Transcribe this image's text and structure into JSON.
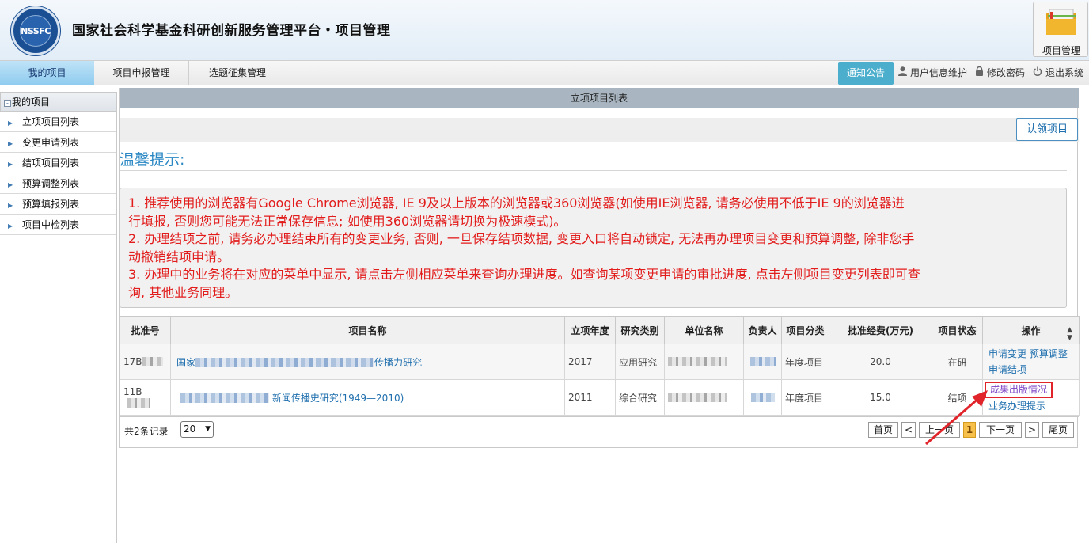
{
  "header": {
    "logo_text": "NSSFC",
    "title": "国家社会科学基金科研创新服务管理平台・项目管理",
    "module_label": "项目管理"
  },
  "nav": {
    "tabs": [
      "我的项目",
      "项目申报管理",
      "选题征集管理"
    ],
    "notice": "通知公告",
    "user_info": "用户信息维护",
    "change_pwd": "修改密码",
    "logout": "退出系统"
  },
  "sidebar": {
    "header": "我的项目",
    "items": [
      "立项项目列表",
      "变更申请列表",
      "结项项目列表",
      "预算调整列表",
      "预算填报列表",
      "项目中检列表"
    ]
  },
  "main": {
    "panel_title": "立项项目列表",
    "claim_button": "认领项目",
    "tips_title": "温馨提示:",
    "tips": [
      "1. 推荐使用的浏览器有Google Chrome浏览器, IE 9及以上版本的浏览器或360浏览器(如使用IE浏览器, 请务必使用不低于IE 9的浏览器进",
      "行填报, 否则您可能无法正常保存信息; 如使用360浏览器请切换为极速模式)。",
      "2. 办理结项之前, 请务必办理结束所有的变更业务, 否则, 一旦保存结项数据, 变更入口将自动锁定, 无法再办理项目变更和预算调整, 除非您手",
      "动撤销结项申请。",
      "3. 办理中的业务将在对应的菜单中显示, 请点击左侧相应菜单来查询办理进度。如查询某项变更申请的审批进度, 点击左侧项目变更列表即可查",
      "询, 其他业务同理。"
    ]
  },
  "table": {
    "columns": [
      "批准号",
      "项目名称",
      "立项年度",
      "研究类别",
      "单位名称",
      "负责人",
      "项目分类",
      "批准经费(万元)",
      "项目状态",
      "操作"
    ],
    "rows": [
      {
        "id_prefix": "17B",
        "name_prefix": "国家",
        "name_suffix": "传播力研究",
        "year": "2017",
        "category": "应用研究",
        "type": "年度项目",
        "funding": "20.0",
        "status": "在研",
        "ops": [
          "申请变更",
          "预算调整",
          "申请结项"
        ]
      },
      {
        "id_prefix": "11B",
        "name_prefix": "",
        "name_suffix": "新闻传播史研究(1949—2010)",
        "year": "2011",
        "category": "综合研究",
        "type": "年度项目",
        "funding": "15.0",
        "status": "结项",
        "ops": [
          "成果出版情况",
          "业务办理提示"
        ]
      }
    ]
  },
  "pager": {
    "record_count": "共2条记录",
    "page_size": "20",
    "first": "首页",
    "prev": "<",
    "up": "上一页",
    "current": "1",
    "down": "下一页",
    "next": ">",
    "last": "尾页"
  },
  "colors": {
    "accent": "#2b88c4",
    "warning_text": "#e21b1b",
    "highlight_box": "#e0242a",
    "active_tab": "#8ecbef",
    "notice_btn": "#4aaecc"
  }
}
